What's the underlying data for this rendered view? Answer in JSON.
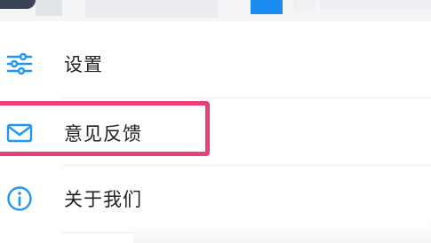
{
  "menu": {
    "items": [
      {
        "label": "设置",
        "icon": "settings-sliders-icon"
      },
      {
        "label": "意见反馈",
        "icon": "mail-icon"
      },
      {
        "label": "关于我们",
        "icon": "info-icon"
      }
    ]
  },
  "colors": {
    "icon_blue": "#2196f3",
    "highlight_pink": "#ea3d7a",
    "text": "#222222"
  }
}
